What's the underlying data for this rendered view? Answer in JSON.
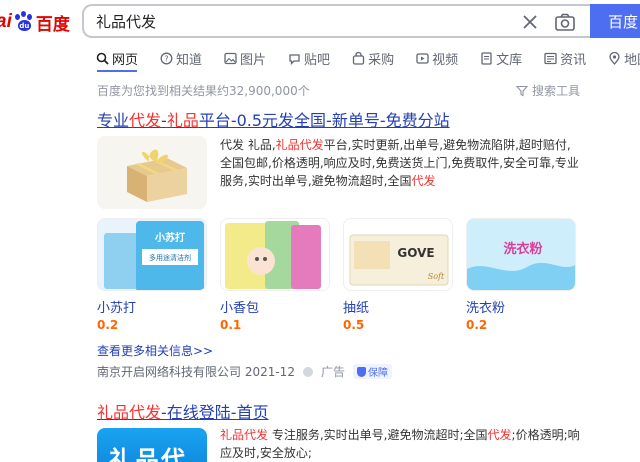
{
  "header": {
    "logo_fragment": "ai",
    "logo_paw_text": "du",
    "logo_text": "百度",
    "search_query": "礼品代发",
    "search_button_label": "百度一"
  },
  "tabs": [
    {
      "label": "网页",
      "icon": "search-icon",
      "active": true
    },
    {
      "label": "知道",
      "icon": "question-icon"
    },
    {
      "label": "图片",
      "icon": "image-icon"
    },
    {
      "label": "贴吧",
      "icon": "tieba-icon"
    },
    {
      "label": "采购",
      "icon": "shopping-icon"
    },
    {
      "label": "视频",
      "icon": "video-icon"
    },
    {
      "label": "文库",
      "icon": "document-icon"
    },
    {
      "label": "资讯",
      "icon": "news-icon"
    },
    {
      "label": "地图",
      "icon": "map-pin-icon"
    }
  ],
  "result_count": "百度为您找到相关结果约32,900,000个",
  "search_tools": "搜索工具",
  "result1": {
    "title_parts": [
      "专业",
      "代发",
      "-",
      "礼品",
      "平台-0.5元发全国-新单号-免费分站"
    ],
    "desc_parts": [
      "代发 礼品,",
      "礼品代发",
      "平台,实时更新,出单号,避免物流陷阱,超时赔付,全国包邮,价格透明,响应及时,免费送货上门,免费取件,安全可靠,专业服务,实时出单号,避免物流超时,全国",
      "代发"
    ],
    "products": [
      {
        "name": "小苏打",
        "price": "0.2"
      },
      {
        "name": "小香包",
        "price": "0.1"
      },
      {
        "name": "抽纸",
        "price": "0.5"
      },
      {
        "name": "洗衣粉",
        "price": "0.2"
      }
    ],
    "product_img_text": {
      "soda_brand": "小苏打",
      "soda_sub": "多用途清洁剂",
      "tissue_brand": "GOVE",
      "tissue_tag": "Soft",
      "powder_brand": "洗衣粉"
    },
    "more_link": "查看更多相关信息>>",
    "source": "南京开启网络科技有限公司 2021-12",
    "ad_label": "广告",
    "badge": "保障"
  },
  "result2": {
    "title_parts": [
      "礼品代发",
      "-在线登陆-首页"
    ],
    "desc_parts": [
      "礼品代发",
      " 专注服务,实时出单号,避免物流超时;全国",
      "代发",
      ";价格透明;响应及时,安全放心;"
    ],
    "img_text": "礼品代发"
  },
  "colors": {
    "brand_red": "#e10601",
    "brand_blue": "#2932e1",
    "link_blue": "#2440b3",
    "highlight_red": "#f73131",
    "price_orange": "#ff6600",
    "search_button": "#4e6ef2"
  }
}
